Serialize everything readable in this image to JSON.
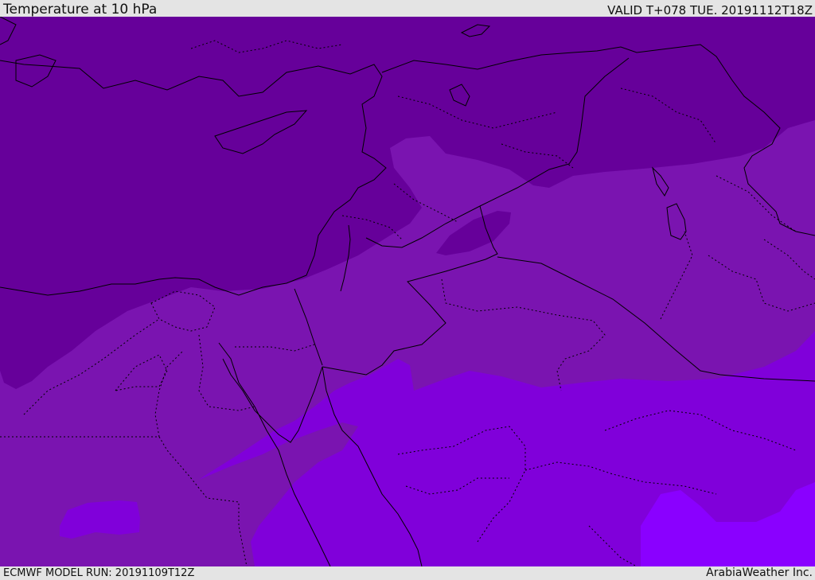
{
  "header": {
    "title": "Temperature at 10 hPa",
    "valid": "VALID T+078 TUE. 20191112T18Z"
  },
  "footer": {
    "model_run": "ECMWF MODEL RUN: 20191109T12Z",
    "credit": "ArabiaWeather Inc."
  },
  "colors": {
    "band_coldest": "#66009a",
    "band_cold": "#7a14b0",
    "band_mild": "#8000da",
    "band_warmest": "#8a00ff",
    "border_line": "#000000",
    "header_bg": "#e4e4e4"
  }
}
